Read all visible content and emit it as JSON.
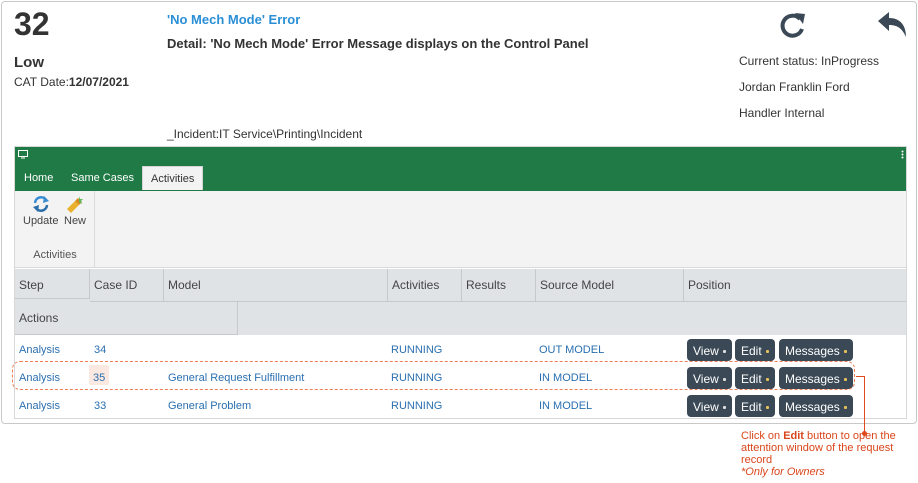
{
  "header": {
    "case_number": "32",
    "priority": "Low",
    "cat_date_label": "CAT Date:",
    "cat_date_value": "12/07/2021",
    "title": "'No Mech Mode' Error",
    "detail": "Detail: 'No Mech Mode' Error Message displays on the Control Panel",
    "path": "_Incident:IT Service\\Printing\\Incident",
    "status": "Current status: InProgress",
    "owner": "Jordan Franklin Ford",
    "handler": "Handler Internal"
  },
  "tabs": [
    "Home",
    "Same Cases",
    "Activities"
  ],
  "ribbon": {
    "update_label": "Update",
    "new_label": "New",
    "group_label": "Activities"
  },
  "grid": {
    "columns": [
      "Step",
      "Case ID",
      "Model",
      "Activities",
      "Results",
      "Source Model",
      "Position"
    ],
    "actions_label": "Actions",
    "rows": [
      {
        "step": "Analysis",
        "case_id": "34",
        "model": "",
        "activities": "RUNNING",
        "results": "",
        "source_model": "OUT MODEL"
      },
      {
        "step": "Analysis",
        "case_id": "35",
        "model": "General Request Fulfillment",
        "activities": "RUNNING",
        "results": "",
        "source_model": "IN MODEL"
      },
      {
        "step": "Analysis",
        "case_id": "33",
        "model": "General Problem",
        "activities": "RUNNING",
        "results": "",
        "source_model": "IN MODEL"
      }
    ],
    "buttons": [
      "View",
      "Edit",
      "Messages"
    ]
  },
  "callout": {
    "prefix": "Click on ",
    "bold": "Edit",
    "rest": " button to open the attention window of the request record",
    "note": "*Only for Owners"
  },
  "colors": {
    "green": "#207a45",
    "link": "#2a6fb0",
    "accent": "#d9461b",
    "button": "#3b4956"
  }
}
